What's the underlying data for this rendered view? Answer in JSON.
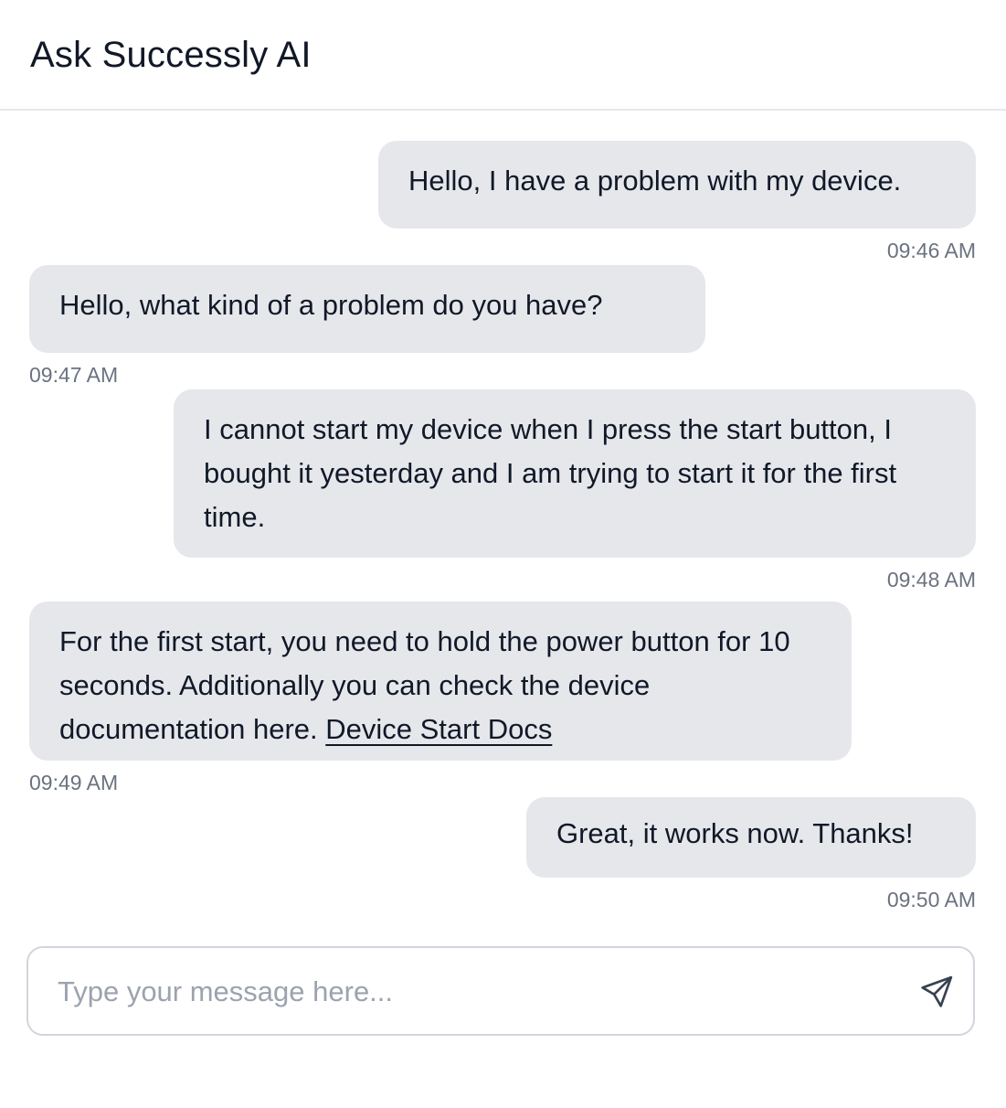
{
  "header": {
    "title": "Ask Successly AI"
  },
  "messages": [
    {
      "role": "user",
      "text": "Hello, I have a problem with my device.",
      "time": "09:46 AM"
    },
    {
      "role": "assistant",
      "text": "Hello, what kind of a problem do you have?",
      "time": "09:47 AM"
    },
    {
      "role": "user",
      "text": "I cannot start my device when I press the start button, I bought it yesterday and I am trying to start it for the first time.",
      "time": "09:48 AM"
    },
    {
      "role": "assistant",
      "text": "For the first start, you need to hold the power button for 10 seconds. Additionally you can check the device documentation here.",
      "link_text": "Device Start Docs",
      "time": "09:49 AM"
    },
    {
      "role": "user",
      "text": "Great, it works now. Thanks!",
      "time": "09:50 AM"
    }
  ],
  "composer": {
    "placeholder": "Type your message here...",
    "value": "",
    "send_icon": "send-icon"
  },
  "colors": {
    "bubble_bg": "#e5e7eb",
    "text": "#111827",
    "timestamp": "#6b7280",
    "placeholder": "#9ca3af",
    "border": "#d1d5db"
  }
}
